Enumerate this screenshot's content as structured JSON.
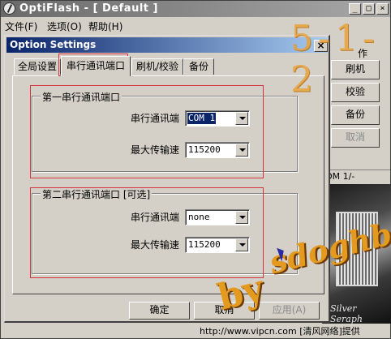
{
  "main_window": {
    "title": "OptiFlash - [ Default ]",
    "menu": [
      "文件(F)",
      "选项(O)",
      "帮助(H)"
    ],
    "side_label": "作",
    "side_buttons": [
      {
        "label": "刷机",
        "enabled": true
      },
      {
        "label": "校验",
        "enabled": true
      },
      {
        "label": "备份",
        "enabled": true
      },
      {
        "label": "取消",
        "enabled": false
      }
    ],
    "com_status": "OM 1/-",
    "image_caption": "Silver Seraph",
    "caption_buttons": {
      "minimize": "_",
      "maximize": "□",
      "close": "×"
    }
  },
  "dialog": {
    "title": "Option Settings",
    "close_glyph": "×",
    "tabs": [
      "全局设置",
      "串行通讯端口",
      "刷机/校验",
      "备份"
    ],
    "active_tab": 1,
    "groups": [
      {
        "title": "第一串行通讯端口",
        "fields": [
          {
            "label": "串行通讯端",
            "value": "COM 1",
            "selected": true
          },
          {
            "label": "最大传输速",
            "value": "115200",
            "selected": false
          }
        ]
      },
      {
        "title": "第二串行通讯端口 [可选]",
        "fields": [
          {
            "label": "串行通讯端",
            "value": "none",
            "selected": false
          },
          {
            "label": "最大传输速",
            "value": "115200",
            "selected": false
          }
        ]
      }
    ],
    "buttons": [
      {
        "label": "确定",
        "enabled": true
      },
      {
        "label": "取消",
        "enabled": true
      },
      {
        "label": "应用(A)",
        "enabled": false
      }
    ]
  },
  "watermarks": {
    "top": "5-1-2",
    "bottom_by": "by",
    "bottom_name": "sdoghb"
  },
  "footer_credit": "http://www.vipcn.com [清风网络]提供",
  "colors": {
    "dialog_title_start": "#0a246a",
    "dialog_title_end": "#a6caf0",
    "face": "#d4d0c8",
    "highlight_red": "#d8323c",
    "watermark_orange": "#e39a1e"
  }
}
